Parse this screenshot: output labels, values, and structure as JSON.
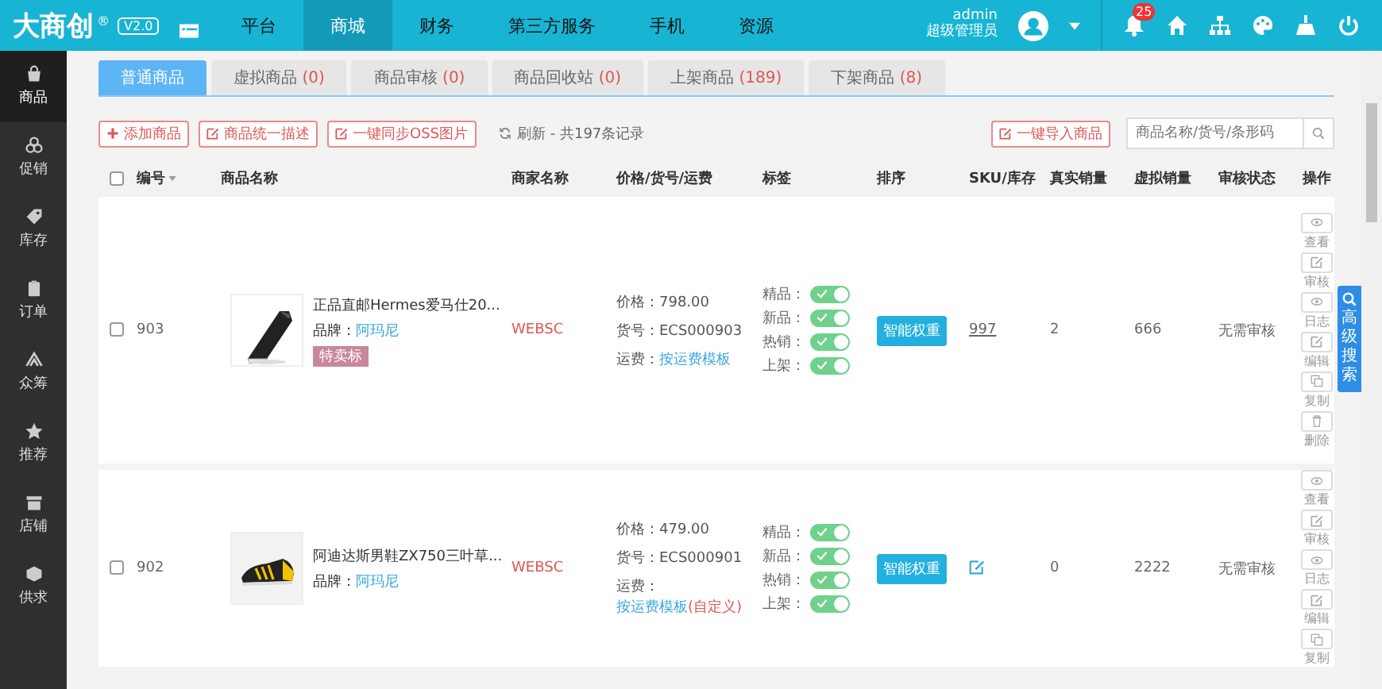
{
  "logo": {
    "name": "大商创",
    "mark": "®",
    "version": "V2.0"
  },
  "nav": [
    {
      "label": "平台",
      "selected": false
    },
    {
      "label": "商城",
      "selected": true
    },
    {
      "label": "财务",
      "selected": false
    },
    {
      "label": "第三方服务",
      "selected": false
    },
    {
      "label": "手机",
      "selected": false
    },
    {
      "label": "资源",
      "selected": false
    }
  ],
  "user": {
    "name": "admin",
    "role": "超级管理员"
  },
  "notifications": "25",
  "sidebar": [
    {
      "label": "商品",
      "kind": "bag",
      "selected": true
    },
    {
      "label": "促销",
      "kind": "circles",
      "selected": false
    },
    {
      "label": "库存",
      "kind": "tag",
      "selected": false
    },
    {
      "label": "订单",
      "kind": "clipboard",
      "selected": false
    },
    {
      "label": "众筹",
      "kind": "people",
      "selected": false
    },
    {
      "label": "推荐",
      "kind": "star",
      "selected": false
    },
    {
      "label": "店铺",
      "kind": "store",
      "selected": false
    },
    {
      "label": "供求",
      "kind": "cube",
      "selected": false
    }
  ],
  "tabs": [
    {
      "label": "普通商品",
      "selected": true
    },
    {
      "label": "虚拟商品",
      "count": "(0)",
      "selected": false
    },
    {
      "label": "商品审核",
      "count": "(0)",
      "selected": false
    },
    {
      "label": "商品回收站",
      "count": "(0)",
      "selected": false
    },
    {
      "label": "上架商品",
      "count": "(189)",
      "selected": false
    },
    {
      "label": "下架商品",
      "count": "(8)",
      "selected": false
    }
  ],
  "toolbar": {
    "buttons": [
      {
        "label": "添加商品",
        "kind": "add"
      },
      {
        "label": "商品统一描述",
        "kind": "edit"
      },
      {
        "label": "一键同步OSS图片",
        "kind": "edit"
      }
    ],
    "refresh": "刷新 - 共197条记录",
    "import": "一键导入商品",
    "search": {
      "placeholder": "商品名称/货号/条形码"
    }
  },
  "table": {
    "select_all_checked": false,
    "columns": [
      "编号",
      "商品名称",
      "商家名称",
      "价格/货号/运费",
      "标签",
      "排序",
      "SKU/库存",
      "真实销量",
      "虚拟销量",
      "审核状态",
      "操作"
    ],
    "rows": [
      {
        "checked": false,
        "id": "903",
        "name": "正品直邮Hermes爱马仕20...",
        "brand_label": "品牌：",
        "brand": "阿玛尼",
        "badge": "特卖标",
        "merchant": "WEBSC",
        "price": "价格：798.00",
        "sn": "货号：ECS000903",
        "shipping": {
          "label": "运费：",
          "link": "按运费模板"
        },
        "tags": [
          {
            "label": "精品：",
            "on": true
          },
          {
            "label": "新品：",
            "on": true
          },
          {
            "label": "热销：",
            "on": true
          },
          {
            "label": "上架：",
            "on": true
          }
        ],
        "sort": "智能权重",
        "sku": "997",
        "real": "2",
        "virtual": "666",
        "status": "无需审核",
        "actions": [
          {
            "label": "查看",
            "kind": "view"
          },
          {
            "label": "审核",
            "kind": "edit"
          },
          {
            "label": "日志",
            "kind": "view"
          },
          {
            "label": "编辑",
            "kind": "edit"
          },
          {
            "label": "复制",
            "kind": "copy"
          },
          {
            "label": "删除",
            "kind": "delete"
          }
        ]
      },
      {
        "checked": false,
        "id": "902",
        "name": "阿迪达斯男鞋ZX750三叶草...",
        "brand_label": "品牌：",
        "brand": "阿玛尼",
        "merchant": "WEBSC",
        "price": "价格：479.00",
        "sn": "货号：ECS000901",
        "shipping": {
          "label": "运费：",
          "link": "按运费模板",
          "note": "(自定义)"
        },
        "tags": [
          {
            "label": "精品：",
            "on": true
          },
          {
            "label": "新品：",
            "on": true
          },
          {
            "label": "热销：",
            "on": true
          },
          {
            "label": "上架：",
            "on": true
          }
        ],
        "sort": "智能权重",
        "sku_edit": true,
        "real": "0",
        "virtual": "2222",
        "status": "无需审核",
        "actions": [
          {
            "label": "查看",
            "kind": "view"
          },
          {
            "label": "审核",
            "kind": "edit"
          },
          {
            "label": "日志",
            "kind": "view"
          },
          {
            "label": "编辑",
            "kind": "edit"
          },
          {
            "label": "复制",
            "kind": "copy"
          }
        ]
      }
    ]
  },
  "advanced_search": "高级搜索"
}
